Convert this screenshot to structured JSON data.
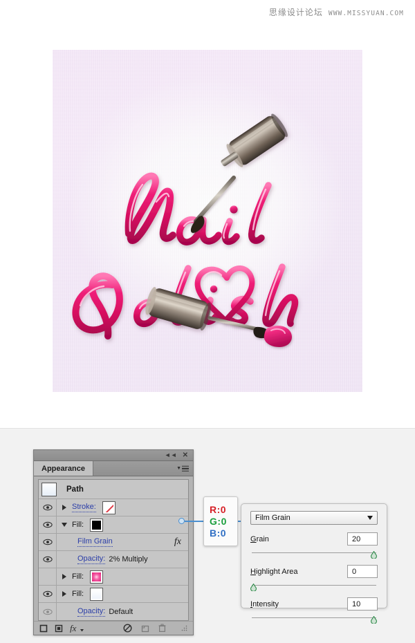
{
  "watermark": {
    "cn_text": "思缘设计论坛",
    "url_text": "WWW.MISSYUAN.COM"
  },
  "artwork": {
    "title_line1": "Nail",
    "title_line2": "Polish",
    "description": "Glossy pink nail-polish lettering artwork with two metallic nail polish brushes and a heart",
    "background_colors": [
      "#f4e6f8",
      "#ffffff",
      "#f0e4f6"
    ],
    "lettering_colors": [
      "#e8156f",
      "#ff6fae",
      "#ffffff",
      "#a8064d"
    ]
  },
  "panel": {
    "tab_label": "Appearance",
    "collapse_icon": "double-left-chevron-icon",
    "close_icon": "close-icon",
    "menu_icon": "panel-menu-icon",
    "header": {
      "name": "Path",
      "thumbnail": "path-thumbnail"
    },
    "rows": [
      {
        "id": "stroke",
        "eye": "visible",
        "disclosure": "collapsed",
        "label": "Stroke:",
        "label_style": "link",
        "swatch": "none",
        "value": "",
        "fx": false
      },
      {
        "id": "fill-black",
        "eye": "visible",
        "disclosure": "expanded",
        "label": "Fill:",
        "label_style": "plain",
        "swatch": "black",
        "value": "",
        "fx": false
      },
      {
        "id": "film-grain-effect",
        "eye": "visible",
        "disclosure": "none",
        "label": "Film Grain",
        "label_style": "link",
        "swatch": "",
        "value": "",
        "fx": true
      },
      {
        "id": "opacity-multiply",
        "eye": "visible",
        "disclosure": "none",
        "label": "Opacity:",
        "label_style": "link",
        "swatch": "",
        "value": "2% Multiply",
        "fx": false
      },
      {
        "id": "fill-pink",
        "eye": "hidden",
        "disclosure": "collapsed",
        "label": "Fill:",
        "label_style": "plain",
        "swatch": "pink",
        "value": "",
        "fx": false
      },
      {
        "id": "fill-white",
        "eye": "visible",
        "disclosure": "collapsed",
        "label": "Fill:",
        "label_style": "plain",
        "swatch": "white",
        "value": "",
        "fx": false
      },
      {
        "id": "opacity-default",
        "eye": "dim",
        "disclosure": "none",
        "label": "Opacity:",
        "label_style": "link",
        "swatch": "",
        "value": "Default",
        "fx": false
      }
    ],
    "footer": {
      "add_stroke": "add-new-stroke-icon",
      "add_fill": "add-new-fill-icon",
      "add_effect": "add-effect-fx-icon",
      "clear": "clear-appearance-icon",
      "duplicate": "duplicate-item-icon",
      "delete": "delete-item-icon",
      "grip": "resize-grip-icon"
    }
  },
  "rgb_tooltip": {
    "r_label": "R:",
    "r_value": "0",
    "g_label": "G:",
    "g_value": "0",
    "b_label": "B:",
    "b_value": "0",
    "r_color": "#d61f26",
    "g_color": "#1a9e3c",
    "b_color": "#2f6fc4"
  },
  "film_grain_dialog": {
    "effect_name": "Film Grain",
    "fields": [
      {
        "label": "Grain",
        "value": "20",
        "slider_percent": 98
      },
      {
        "label": "Highlight Area",
        "value": "0",
        "slider_percent": 2
      },
      {
        "label": "Intensity",
        "value": "10",
        "slider_percent": 98
      }
    ],
    "handle_color": "#2f8a4a"
  }
}
